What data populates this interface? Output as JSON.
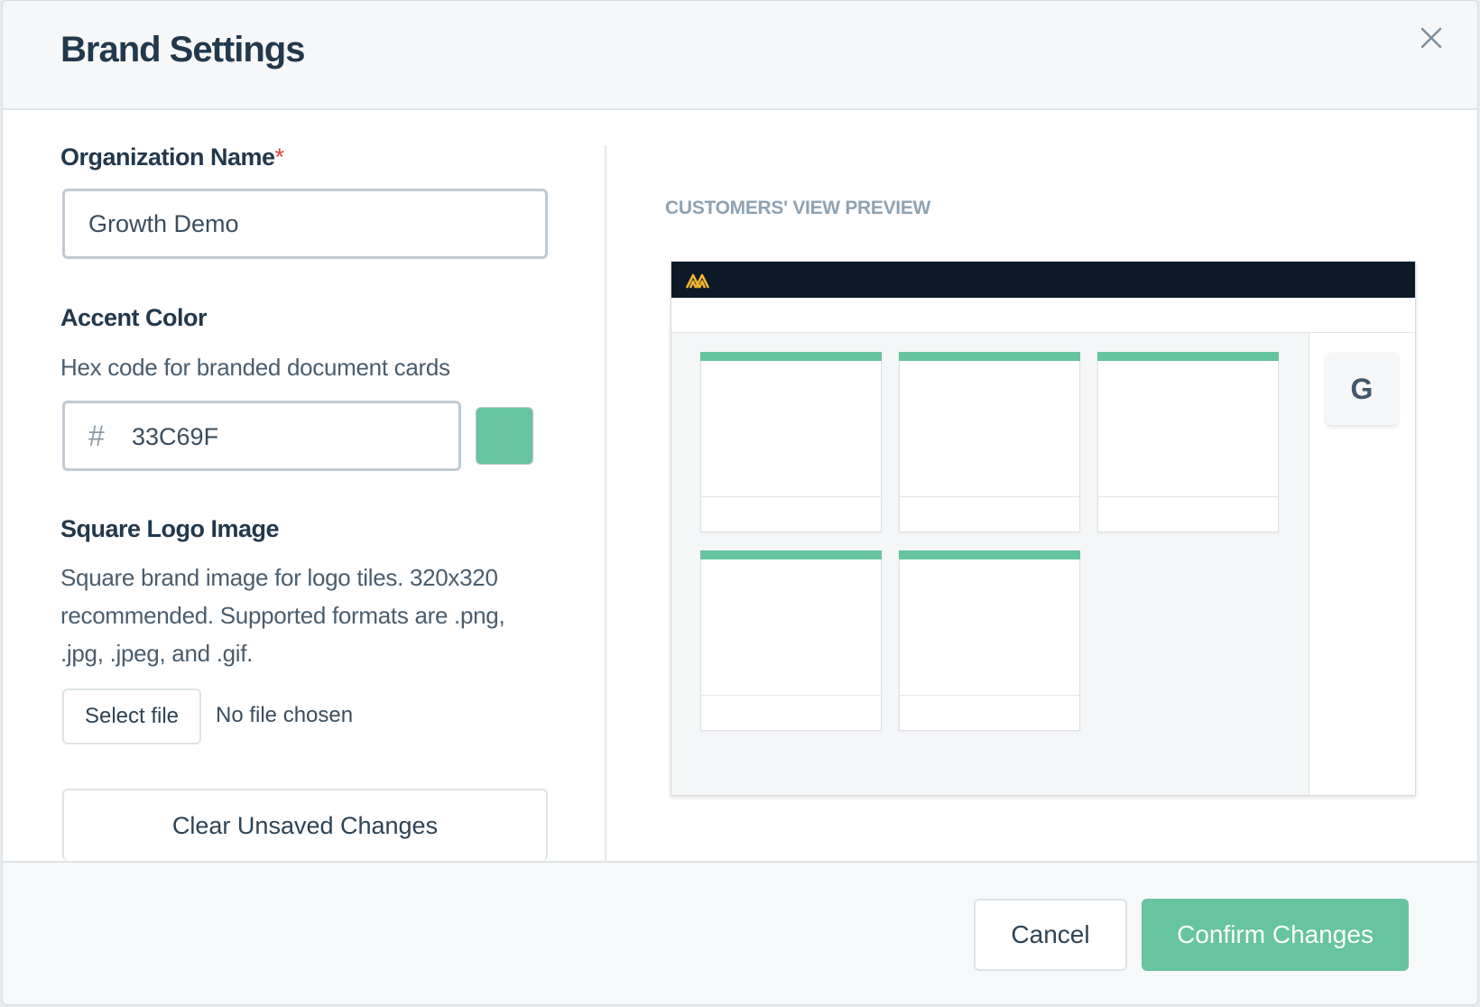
{
  "modal": {
    "title": "Brand Settings",
    "close_icon": "close-icon"
  },
  "form": {
    "org_name": {
      "label": "Organization Name",
      "required_mark": "*",
      "value": "Growth Demo"
    },
    "accent_color": {
      "label": "Accent Color",
      "hint": "Hex code for branded document cards",
      "prefix": "#",
      "value": "33C69F",
      "swatch_color": "#66c4a0"
    },
    "logo": {
      "label": "Square Logo Image",
      "hint": "Square brand image for logo tiles. 320x320 recommended. Supported formats are .png, .jpg, .jpeg, and .gif.",
      "select_label": "Select file",
      "status": "No file chosen"
    },
    "clear_label": "Clear Unsaved Changes"
  },
  "preview": {
    "label": "CUSTOMERS' VIEW PREVIEW",
    "logo_icon": "brand-logo-icon",
    "logo_color": "#f2b233",
    "topbar_color": "#0b1a26",
    "card_accent": "#66c4a0",
    "card_count": 5,
    "tile_letter": "G"
  },
  "footer": {
    "cancel_label": "Cancel",
    "confirm_label": "Confirm Changes",
    "confirm_color": "#66c4a0"
  }
}
